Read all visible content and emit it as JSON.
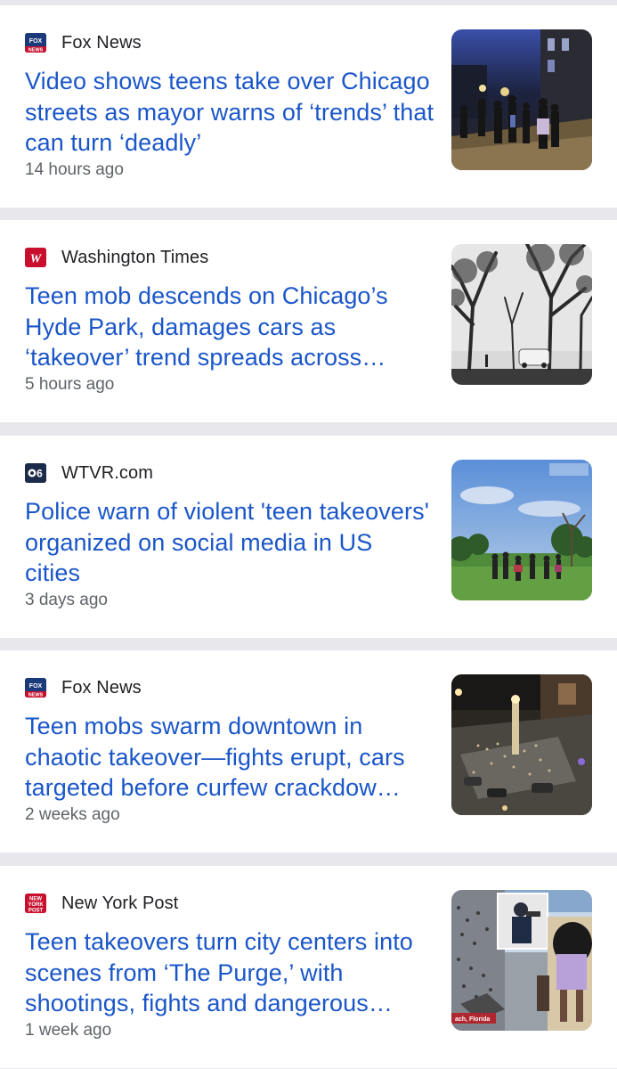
{
  "articles": [
    {
      "source": "Fox News",
      "icon": "fox-news-logo-icon",
      "headline": "Video shows teens take over Chicago streets as mayor warns of ‘trends’ that can turn ‘deadly’",
      "time": "14 hours ago",
      "thumbnail": "night-street-crowd-image"
    },
    {
      "source": "Washington Times",
      "icon": "washington-times-logo-icon",
      "headline": "Teen mob descends on Chicago’s Hyde Park, damages cars as ‘takeover’ trend spreads across…",
      "time": "5 hours ago",
      "thumbnail": "park-trees-image"
    },
    {
      "source": "WTVR.com",
      "icon": "wtvr-logo-icon",
      "headline": "Police warn of violent 'teen takeovers' organized on social media in US cities",
      "time": "3 days ago",
      "thumbnail": "park-crowd-image"
    },
    {
      "source": "Fox News",
      "icon": "fox-news-logo-icon",
      "headline": "Teen mobs swarm downtown in chaotic takeover—fights erupt, cars targeted before curfew crackdow…",
      "time": "2 weeks ago",
      "thumbnail": "aerial-night-plaza-image"
    },
    {
      "source": "New York Post",
      "icon": "new-york-post-logo-icon",
      "headline": "Teen takeovers turn city centers into scenes from ‘The Purge,’ with shootings, fights and dangerous…",
      "time": "1 week ago",
      "thumbnail": "beach-crowd-collage-image",
      "thumb_caption": "ach, Florida"
    }
  ],
  "colors": {
    "headline": "#1a56c9",
    "source": "#202124",
    "time": "#5f6368",
    "divider": "#e8e8ec"
  }
}
